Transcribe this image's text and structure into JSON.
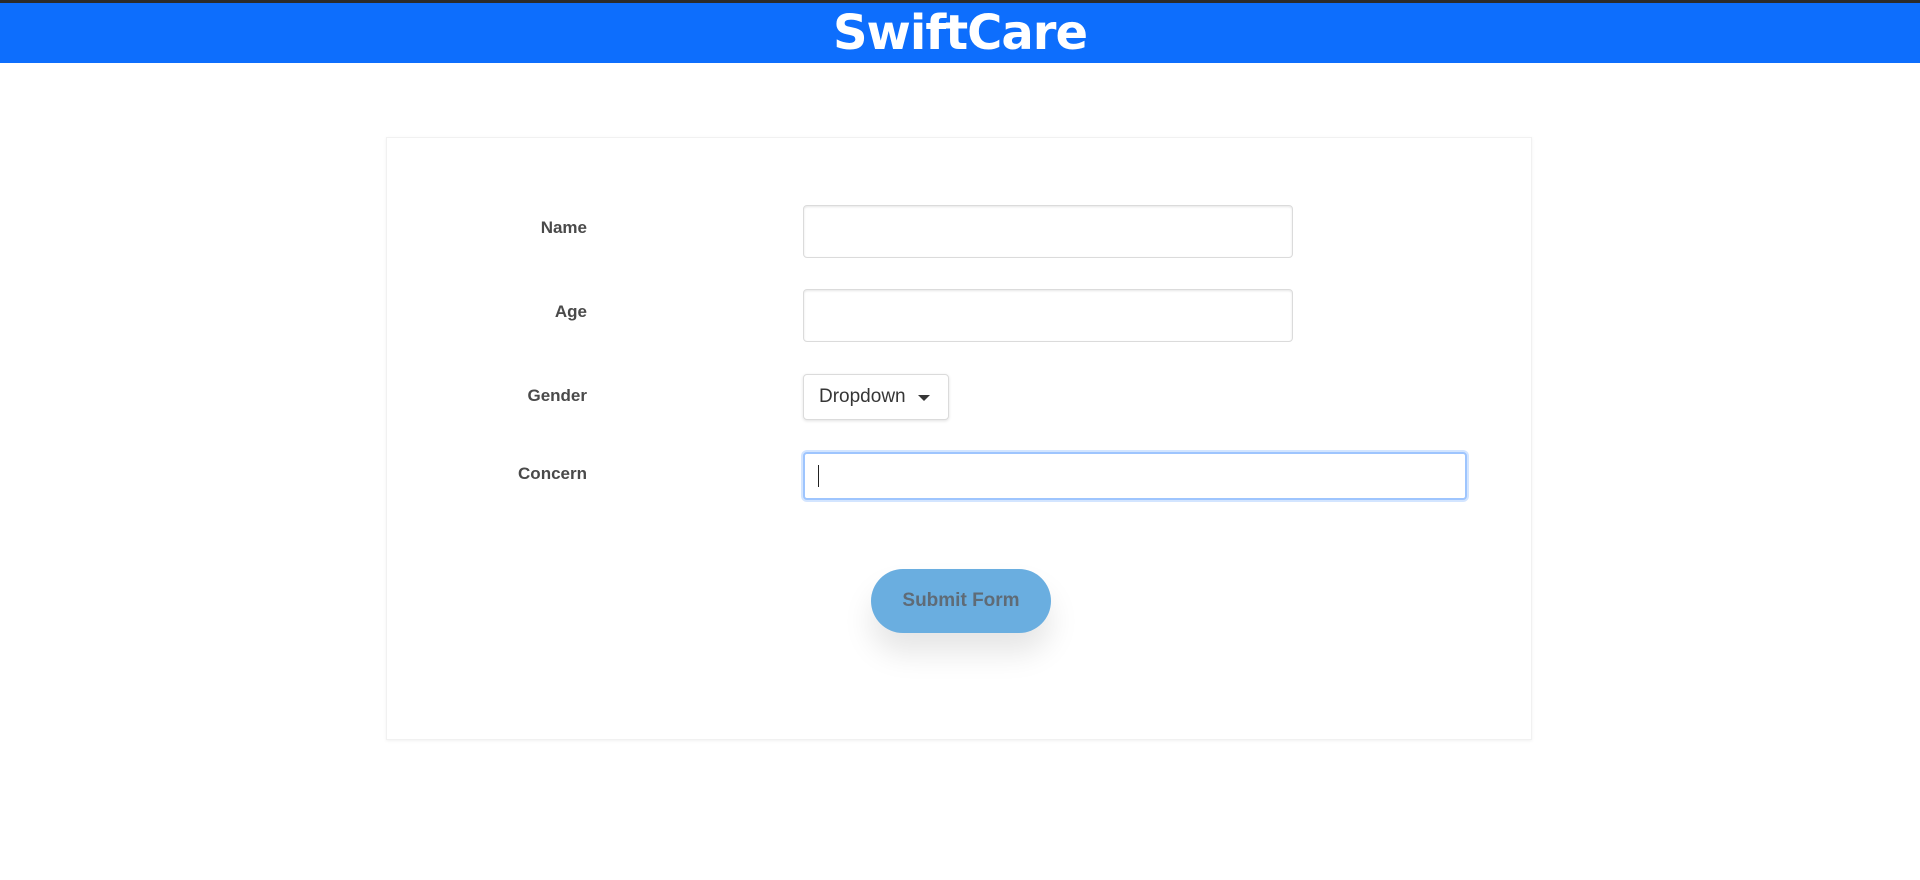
{
  "header": {
    "title": "SwiftCare",
    "background": "#0d6efd"
  },
  "form": {
    "name": {
      "label": "Name",
      "value": ""
    },
    "age": {
      "label": "Age",
      "value": ""
    },
    "gender": {
      "label": "Gender",
      "selected": "Dropdown"
    },
    "concern": {
      "label": "Concern",
      "value": ""
    },
    "submit_label": "Submit Form"
  },
  "colors": {
    "submit_button": "#6aaee0",
    "focus_ring": "#9ec5fe"
  }
}
